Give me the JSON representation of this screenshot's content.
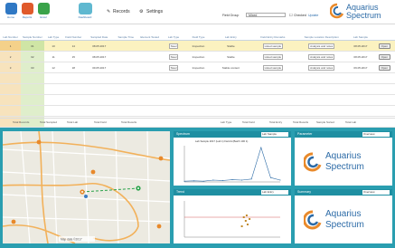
{
  "toolbar": {
    "buttons": [
      {
        "label": "Home",
        "color": "#2f78c4"
      },
      {
        "label": "Reports",
        "color": "#e05a2b"
      },
      {
        "label": "Excel",
        "color": "#3aa34a"
      }
    ],
    "dashboard_label": "Dashboard",
    "records_label": "Records",
    "settings_label": "Settings",
    "filter_label": "Field Group",
    "filter_value": "Mixed",
    "filter_checkbox_label": "Checked",
    "filter_link": "Update"
  },
  "logo": {
    "line1": "Aquarius",
    "line2": "Spectrum"
  },
  "table": {
    "headers": [
      "Lab Number",
      "Sample Number",
      "Lab Type",
      "Field Number",
      "Sampled Date",
      "Sample Time",
      "Element Tested",
      "Lab Type",
      "Field Type",
      "Lab Entry",
      "Field Entry Remarks",
      "Field Entry Remark",
      "Sample Location Description",
      "Lab Sample",
      ""
    ],
    "rows": [
      {
        "cells": [
          "1",
          "01",
          "10",
          "14",
          "08.05.2017",
          "",
          "",
          "Steel",
          "Inspection",
          "Stable",
          "Listed sample",
          "Analysis and notes",
          "08.05.2017",
          "Open"
        ],
        "selected": true
      },
      {
        "cells": [
          "2",
          "02",
          "11",
          "15",
          "08.05.2017",
          "",
          "",
          "Steel",
          "Inspection",
          "Stable",
          "Listed sample",
          "Analysis and notes",
          "08.05.2017",
          "Open"
        ],
        "selected": false
      },
      {
        "cells": [
          "3",
          "03",
          "12",
          "18",
          "09.05.2017",
          "",
          "",
          "Steel",
          "Inspection",
          "Stable content",
          "Listed sample",
          "Analysis and notes",
          "09.05.2017",
          "Open"
        ],
        "selected": false
      },
      {
        "cells": [
          "",
          "",
          "",
          "",
          "",
          "",
          "",
          "",
          "",
          "",
          "",
          "",
          "",
          ""
        ],
        "selected": false
      },
      {
        "cells": [
          "",
          "",
          "",
          "",
          "",
          "",
          "",
          "",
          "",
          "",
          "",
          "",
          "",
          ""
        ],
        "selected": false
      },
      {
        "cells": [
          "",
          "",
          "",
          "",
          "",
          "",
          "",
          "",
          "",
          "",
          "",
          "",
          "",
          ""
        ],
        "selected": false
      },
      {
        "cells": [
          "",
          "",
          "",
          "",
          "",
          "",
          "",
          "",
          "",
          "",
          "",
          "",
          "",
          ""
        ],
        "selected": false
      },
      {
        "cells": [
          "",
          "",
          "",
          "",
          "",
          "",
          "",
          "",
          "",
          "",
          "",
          "",
          "",
          ""
        ],
        "selected": false
      }
    ]
  },
  "footer": [
    "Total Records",
    "Total Sampled",
    "Total Lab",
    "Total Field",
    "Total Results",
    "Lab Type",
    "Total Field",
    "Total Entry",
    "Total Results",
    "Sample Sorted",
    "Total Lab"
  ],
  "map": {
    "attribution": "Map data ©2017"
  },
  "panels": {
    "spectrum": {
      "title": "Spectrum",
      "dropdown": "Lab Sample",
      "chart_title": "Lab Sample 2017 (Lab 1) Field A (Batch 100 1)"
    },
    "trend": {
      "title": "Trend",
      "dropdown": "Lab Entry"
    },
    "right_top": {
      "title": "Parameter",
      "dropdown": "Overview"
    },
    "right_bottom": {
      "title": "Summary",
      "dropdown": "Overview"
    }
  },
  "chart_data": [
    {
      "type": "line",
      "title": "Lab Sample 2017 (Lab 1) Field A (Batch 100 1)",
      "x": [
        0,
        10,
        20,
        30,
        40,
        50,
        60,
        70,
        80,
        90,
        100
      ],
      "y": [
        0.02,
        0.03,
        0.02,
        0.05,
        0.04,
        0.06,
        0.05,
        0.08,
        0.95,
        0.12,
        0.05
      ]
    },
    {
      "type": "scatter",
      "x": [
        60,
        62,
        64,
        65,
        66,
        68
      ],
      "y": [
        0.3,
        0.55,
        0.45,
        0.6,
        0.35,
        0.5
      ]
    }
  ]
}
